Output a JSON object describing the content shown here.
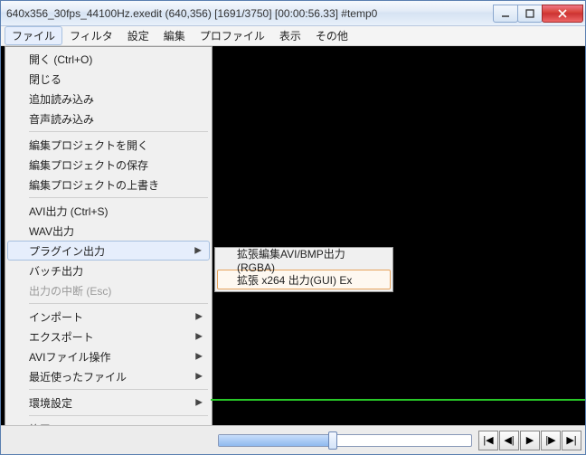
{
  "title": "640x356_30fps_44100Hz.exedit (640,356)  [1691/3750]  [00:00:56.33]  #temp0",
  "menubar": [
    "ファイル",
    "フィルタ",
    "設定",
    "編集",
    "プロファイル",
    "表示",
    "その他"
  ],
  "menubar_open_index": 0,
  "dropdown": {
    "groups": [
      [
        {
          "label": "開く (Ctrl+O)",
          "arrow": false
        },
        {
          "label": "閉じる",
          "arrow": false
        },
        {
          "label": "追加読み込み",
          "arrow": false
        },
        {
          "label": "音声読み込み",
          "arrow": false
        }
      ],
      [
        {
          "label": "編集プロジェクトを開く",
          "arrow": false
        },
        {
          "label": "編集プロジェクトの保存",
          "arrow": false
        },
        {
          "label": "編集プロジェクトの上書き",
          "arrow": false
        }
      ],
      [
        {
          "label": "AVI出力 (Ctrl+S)",
          "arrow": false
        },
        {
          "label": "WAV出力",
          "arrow": false
        },
        {
          "label": "プラグイン出力",
          "arrow": true,
          "highlight": true
        },
        {
          "label": "バッチ出力",
          "arrow": false
        },
        {
          "label": "出力の中断 (Esc)",
          "arrow": false,
          "disabled": true
        }
      ],
      [
        {
          "label": "インポート",
          "arrow": true
        },
        {
          "label": "エクスポート",
          "arrow": true
        },
        {
          "label": "AVIファイル操作",
          "arrow": true
        },
        {
          "label": "最近使ったファイル",
          "arrow": true
        }
      ],
      [
        {
          "label": "環境設定",
          "arrow": true
        }
      ],
      [
        {
          "label": "終了",
          "arrow": false
        }
      ]
    ]
  },
  "submenu": {
    "items": [
      {
        "label": "拡張編集AVI/BMP出力 (RGBA)",
        "selected": false
      },
      {
        "label": "拡張 x264 出力(GUI) Ex",
        "selected": true
      }
    ]
  },
  "playback": {
    "progress_percent": 45,
    "buttons": [
      "prev-frame",
      "step-back",
      "play",
      "step-fwd",
      "next-frame"
    ]
  },
  "colors": {
    "highlight_bg": "#e6eefc",
    "highlight_border": "#a7c0e0",
    "selected_border": "#e6a45e"
  }
}
